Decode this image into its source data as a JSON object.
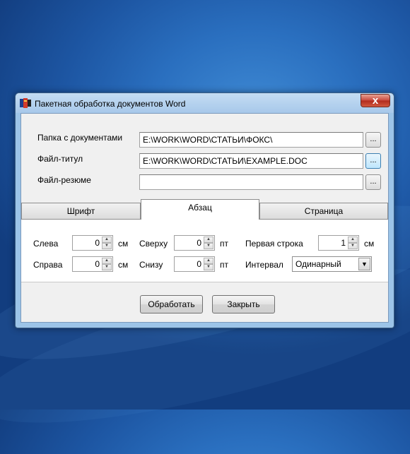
{
  "window": {
    "title": "Пакетная обработка документов Word",
    "close_glyph": "x"
  },
  "fields": [
    {
      "label": "Папка с документами",
      "value": "E:\\WORK\\WORD\\СТАТЬИ\\ФОКС\\",
      "browse": "..."
    },
    {
      "label": "Файл-титул",
      "value": "E:\\WORK\\WORD\\СТАТЬИ\\EXAMPLE.DOC",
      "browse": "..."
    },
    {
      "label": "Файл-резюме",
      "value": "",
      "browse": "..."
    }
  ],
  "tabs": [
    "Шрифт",
    "Абзац",
    "Страница"
  ],
  "active_tab": "Абзац",
  "paragraph": {
    "left": {
      "label": "Слева",
      "value": "0",
      "unit": "см"
    },
    "right": {
      "label": "Справа",
      "value": "0",
      "unit": "см"
    },
    "top": {
      "label": "Сверху",
      "value": "0",
      "unit": "пт"
    },
    "bottom": {
      "label": "Снизу",
      "value": "0",
      "unit": "пт"
    },
    "first_line": {
      "label": "Первая строка",
      "value": "1",
      "unit": "см"
    },
    "interval": {
      "label": "Интервал",
      "value": "Одинарный"
    }
  },
  "buttons": {
    "process": "Обработать",
    "close": "Закрыть"
  },
  "colors": {
    "desktop": "#2a6fbf",
    "titlebar": "#a7c8ea",
    "close": "#c7463a"
  }
}
